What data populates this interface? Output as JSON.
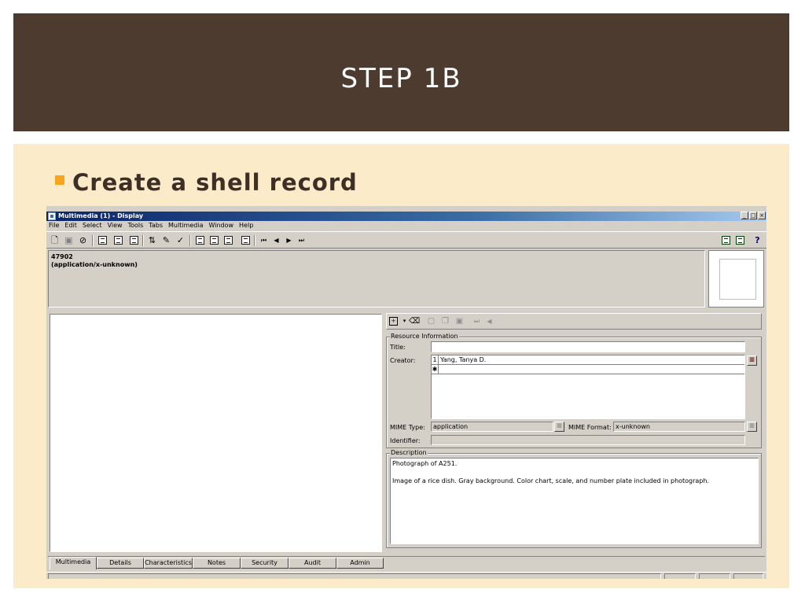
{
  "slide": {
    "title": "STEP 1B",
    "bullet": "Create a shell record",
    "colors": {
      "header": "#4e3b30",
      "body": "#fcebc8",
      "bullet": "#f7a51c"
    }
  },
  "window": {
    "title": "Multimedia (1) - Display",
    "controls": {
      "minimize": "_",
      "maximize": "□",
      "close": "×"
    }
  },
  "menu": [
    "File",
    "Edit",
    "Select",
    "View",
    "Tools",
    "Tabs",
    "Multimedia",
    "Window",
    "Help"
  ],
  "toolbar": {
    "icons": [
      "new-icon",
      "save-icon",
      "cancel-icon",
      "record-a-icon",
      "record-b-icon",
      "record-c-icon",
      "sort-icon",
      "edit-icon",
      "spellcheck-icon",
      "view-a-icon",
      "view-b-icon",
      "view-c-icon",
      "view-d-icon",
      "first-icon",
      "prev-icon",
      "next-icon",
      "last-icon",
      "export-icon",
      "copy-icon",
      "help-pointer-icon"
    ],
    "nav": {
      "first": "⏮",
      "prev": "◀",
      "next": "▶",
      "last": "⏭"
    },
    "help": "?"
  },
  "record": {
    "id": "47902",
    "type": "(application/x-unknown)"
  },
  "resource": {
    "group_label": "Resource Information",
    "title_label": "Title:",
    "title_value": "",
    "creator_label": "Creator:",
    "creators": [
      {
        "index": "1",
        "name": "Yang, Tanya D."
      }
    ],
    "new_row_marker": "✱",
    "mime_type_label": "MIME Type:",
    "mime_type_value": "application",
    "mime_format_label": "MIME Format:",
    "mime_format_value": "x-unknown",
    "identifier_label": "Identifier:",
    "identifier_value": ""
  },
  "description": {
    "group_label": "Description",
    "line1": "Photograph of A251.",
    "line2": "Image of a rice dish. Gray background. Color chart, scale, and number plate included in photograph."
  },
  "tabs": [
    "Multimedia",
    "Details",
    "Characteristics",
    "Notes",
    "Security",
    "Audit",
    "Admin"
  ]
}
